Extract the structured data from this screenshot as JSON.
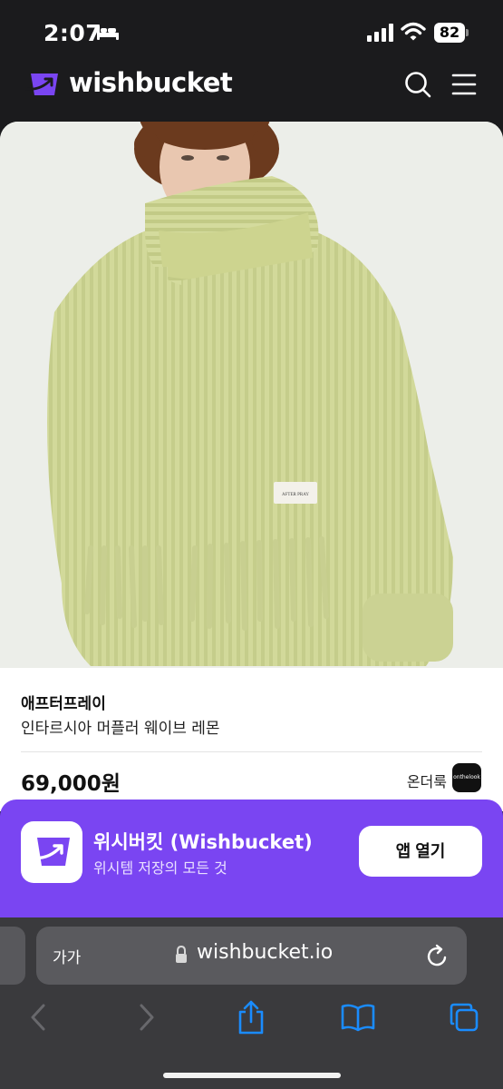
{
  "status_bar": {
    "time": "2:07",
    "battery": "82",
    "icons": [
      "bed-icon",
      "signal-icon",
      "wifi-icon",
      "battery-icon"
    ]
  },
  "header": {
    "logo_text": "wishbucket",
    "icons": [
      "wishbucket-logo-icon",
      "search-icon",
      "menu-icon"
    ]
  },
  "product": {
    "brand": "애프터프레이",
    "name": "인타르시아 머플러 웨이브 레몬",
    "price": "69,000원",
    "shop_name": "온더룩",
    "shop_logo_text": "onthelook",
    "image_label_text": "AFTER PRAY"
  },
  "app_banner": {
    "title": "위시버킷 (Wishbucket)",
    "subtitle": "위시템 저장의 모든 것",
    "open_button": "앱 열기"
  },
  "browser": {
    "text_size_label": "가가",
    "url": "wishbucket.io",
    "icons": [
      "lock-icon",
      "reload-icon",
      "back-icon",
      "forward-icon",
      "share-icon",
      "bookmarks-icon",
      "tabs-icon"
    ]
  },
  "colors": {
    "header_bg": "#1b1b1d",
    "brand_purple": "#7a45f2",
    "browser_bar": "#3a3a3d",
    "browser_icon_blue": "#1a8cff",
    "knit_green": "#d2d99a"
  }
}
